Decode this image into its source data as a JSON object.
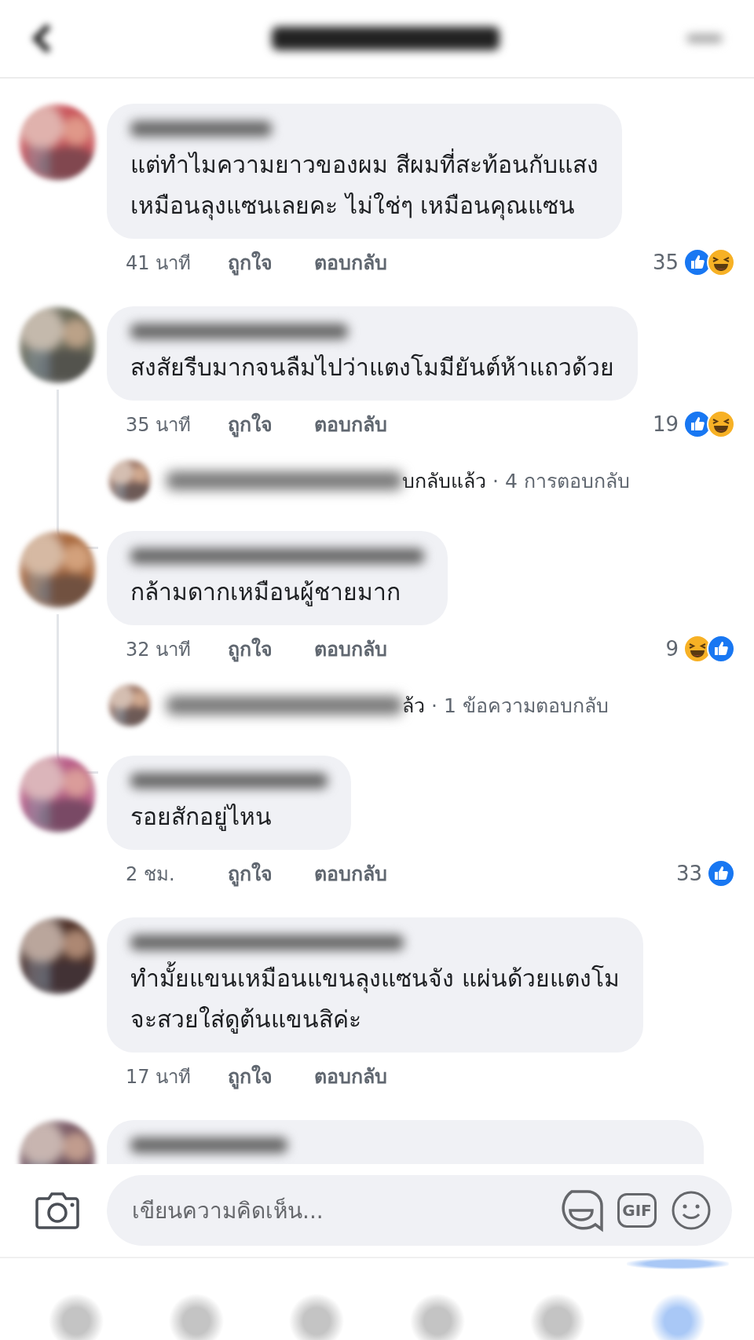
{
  "comments": [
    {
      "text": "แต่ทำไมความยาวของผม สีผมที่สะท้อนกับแสง\nเหมือนลุงแซนเลยคะ ไม่ใช่ๆ เหมือนคุณแซน",
      "time": "41 นาที",
      "like": "ถูกใจ",
      "reply": "ตอบกลับ",
      "count": "35",
      "reactions": [
        {
          "kind": "like"
        },
        {
          "kind": "haha"
        }
      ]
    },
    {
      "text": "สงสัยรีบมากจนลืมไปว่าแตงโมมียันต์ห้าแถวด้วย",
      "time": "35 นาที",
      "like": "ถูกใจ",
      "reply": "ตอบกลับ",
      "count": "19",
      "reactions": [
        {
          "kind": "like"
        },
        {
          "kind": "haha"
        }
      ],
      "replies": {
        "replied": "บกลับแล้ว",
        "summary": "· 4 การตอบกลับ"
      }
    },
    {
      "text": "กล้ามดากเหมือนผู้ชายมาก",
      "time": "32 นาที",
      "like": "ถูกใจ",
      "reply": "ตอบกลับ",
      "count": "9",
      "reactions": [
        {
          "kind": "haha"
        },
        {
          "kind": "like"
        }
      ],
      "replies": {
        "replied": "ล้ว",
        "summary": "· 1 ข้อความตอบกลับ"
      }
    },
    {
      "text": "รอยสักอยู่ไหน",
      "time": "2 ชม.",
      "like": "ถูกใจ",
      "reply": "ตอบกลับ",
      "count": "33",
      "reactions": [
        {
          "kind": "like"
        }
      ]
    },
    {
      "text": "ทำมั้ยแขนเหมือนแขนลุงแซนจัง แผ่นด้วยแตงโม\nจะสวยใส่ดูต้นแขนสิค่ะ",
      "time": "17 นาที",
      "like": "ถูกใจ",
      "reply": "ตอบกลับ"
    },
    {
      "kind": "cut_off"
    }
  ],
  "composer": {
    "placeholder": "เขียนความคิดเห็น...",
    "gif": "GIF"
  },
  "tabs": [
    {
      "selected": false
    },
    {
      "selected": false
    },
    {
      "selected": false
    },
    {
      "selected": false
    },
    {
      "selected": false
    },
    {
      "selected": true
    }
  ]
}
